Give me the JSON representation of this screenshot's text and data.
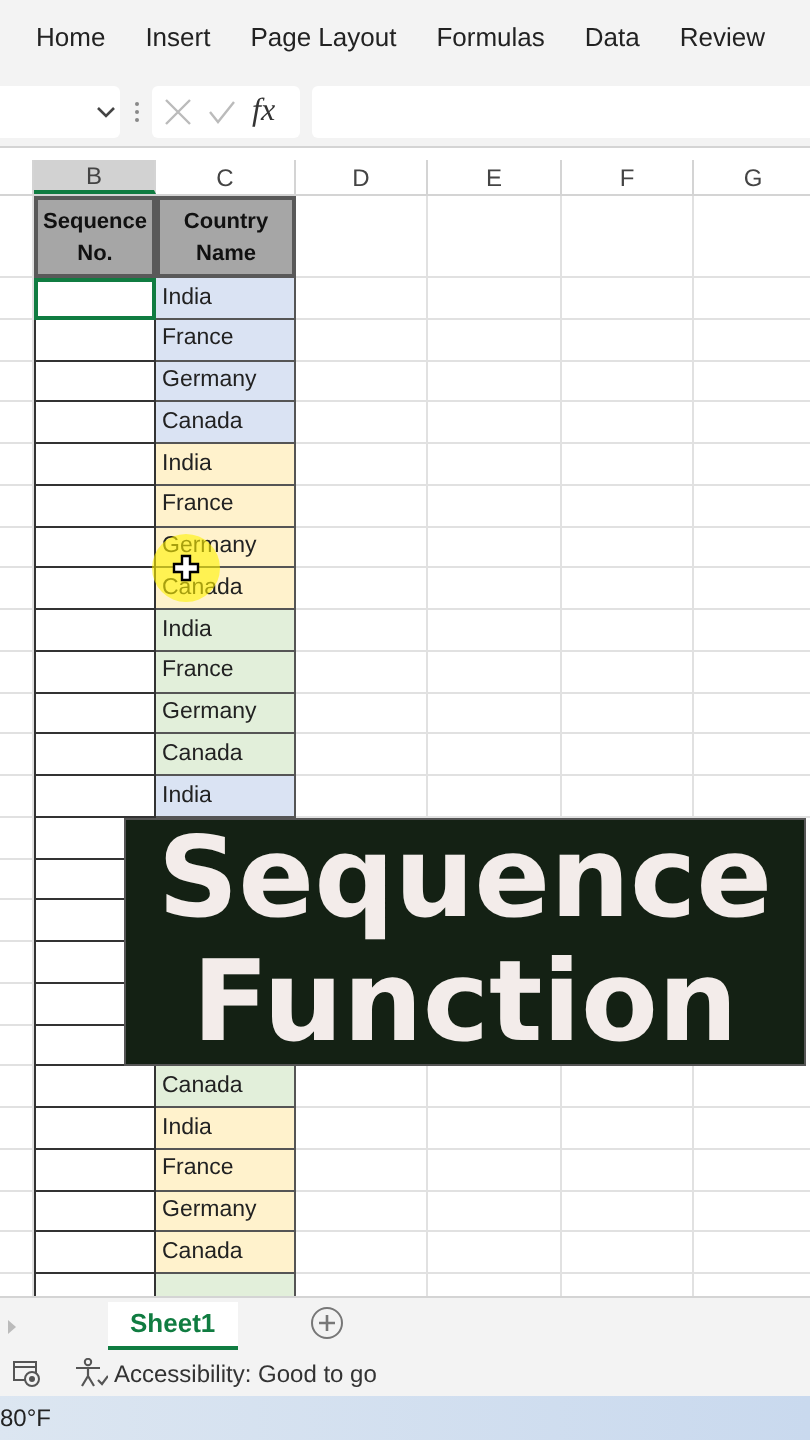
{
  "ribbon_tabs": [
    {
      "label": "Home",
      "selected": false
    },
    {
      "label": "Insert",
      "selected": false
    },
    {
      "label": "Page Layout",
      "selected": false
    },
    {
      "label": "Formulas",
      "selected": false
    },
    {
      "label": "Data",
      "selected": false
    },
    {
      "label": "Review",
      "selected": false
    }
  ],
  "formula_bar": {
    "fx": "fx"
  },
  "columns": [
    {
      "label": "B",
      "selected": true
    },
    {
      "label": "C",
      "selected": false
    },
    {
      "label": "D",
      "selected": false
    },
    {
      "label": "E",
      "selected": false
    },
    {
      "label": "F",
      "selected": false
    },
    {
      "label": "G",
      "selected": false
    }
  ],
  "table_header": [
    "Sequence No.",
    "Country Name"
  ],
  "rows": [
    {
      "country": "India",
      "color": "#dae3f3",
      "selected": true
    },
    {
      "country": "France",
      "color": "#dae3f3",
      "selected": false
    },
    {
      "country": "Germany",
      "color": "#dae3f3",
      "selected": false
    },
    {
      "country": "Canada",
      "color": "#dae3f3",
      "selected": false
    },
    {
      "country": "India",
      "color": "#fff2cc",
      "selected": false
    },
    {
      "country": "France",
      "color": "#fff2cc",
      "selected": false
    },
    {
      "country": "Germany",
      "color": "#fff2cc",
      "selected": false
    },
    {
      "country": "Canada",
      "color": "#fff2cc",
      "selected": false
    },
    {
      "country": "India",
      "color": "#e2efda",
      "selected": false
    },
    {
      "country": "France",
      "color": "#e2efda",
      "selected": false
    },
    {
      "country": "Germany",
      "color": "#e2efda",
      "selected": false
    },
    {
      "country": "Canada",
      "color": "#e2efda",
      "selected": false
    },
    {
      "country": "India",
      "color": "#dae3f3",
      "selected": false
    },
    {
      "selected": false
    },
    {
      "selected": false
    },
    {
      "selected": false
    },
    {
      "selected": false
    },
    {
      "selected": false
    },
    {
      "selected": false
    },
    {
      "country": "Canada",
      "color": "#e2efda",
      "selected": false
    },
    {
      "country": "India",
      "color": "#fff2cc",
      "selected": false
    },
    {
      "country": "France",
      "color": "#fff2cc",
      "selected": false
    },
    {
      "country": "Germany",
      "color": "#fff2cc",
      "selected": false
    },
    {
      "country": "Canada",
      "color": "#fff2cc",
      "selected": false
    },
    {
      "color": "#e2efda",
      "selected": false
    }
  ],
  "overlay_title": [
    "Sequence",
    "Function"
  ],
  "sheet_tabs": [
    {
      "label": "Sheet1",
      "selected": true
    }
  ],
  "status_bar": {
    "accessibility": "Accessibility: Good to go"
  },
  "taskbar": {
    "weather": "80°F"
  }
}
